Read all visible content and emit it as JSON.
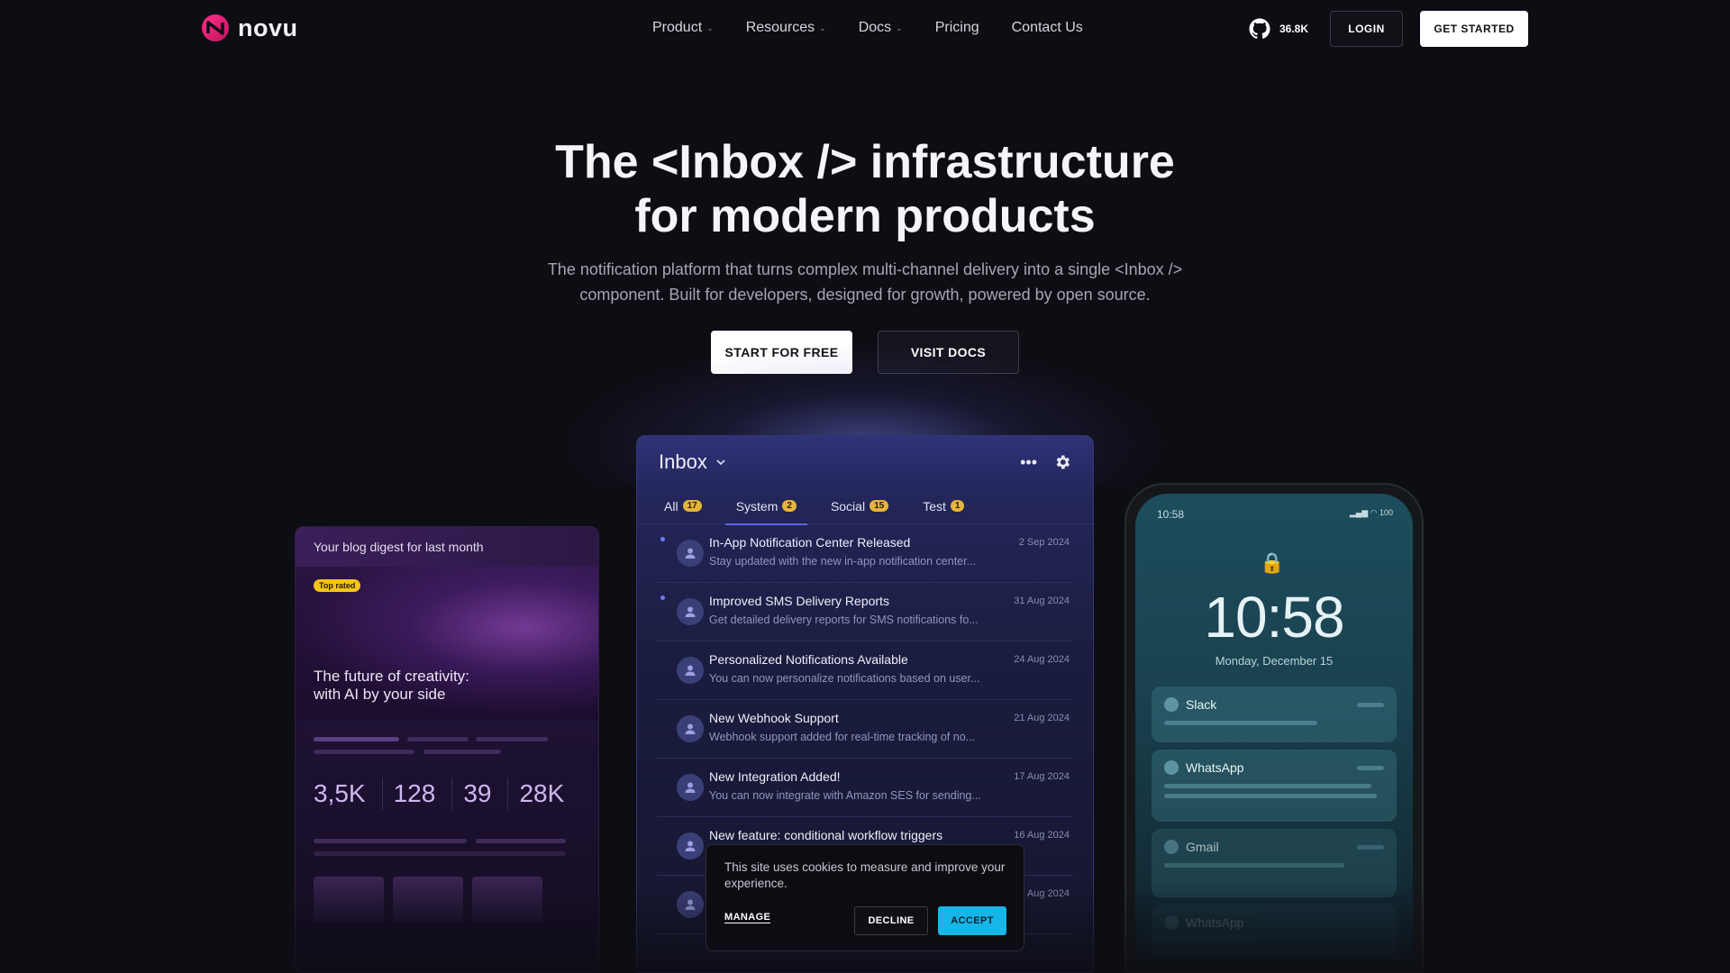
{
  "brand": {
    "name": "novu"
  },
  "nav": {
    "links": [
      {
        "label": "Product",
        "dropdown": true
      },
      {
        "label": "Resources",
        "dropdown": true
      },
      {
        "label": "Docs",
        "dropdown": true
      },
      {
        "label": "Pricing",
        "dropdown": false
      },
      {
        "label": "Contact Us",
        "dropdown": false
      }
    ],
    "github_stars": "36.8K",
    "login_label": "LOGIN",
    "get_started_label": "GET STARTED"
  },
  "hero": {
    "title_line1": "The <Inbox /> infrastructure",
    "title_line2": "for modern products",
    "subtitle_line1": "The notification platform that turns complex multi-channel delivery into a single <Inbox />",
    "subtitle_line2": "component. Built for developers, designed for growth, powered by open source.",
    "cta_primary": "START FOR FREE",
    "cta_secondary": "VISIT DOCS"
  },
  "blog_card": {
    "header": "Your blog digest for last month",
    "badge": "Top rated",
    "headline_line1": "The future of creativity:",
    "headline_line2": "with AI by your side",
    "stats": [
      "3,5K",
      "128",
      "39",
      "28K"
    ]
  },
  "inbox": {
    "title": "Inbox",
    "tabs": [
      {
        "label": "All",
        "count": "17"
      },
      {
        "label": "System",
        "count": "2"
      },
      {
        "label": "Social",
        "count": "15"
      },
      {
        "label": "Test",
        "count": "1"
      }
    ],
    "notifications": [
      {
        "title": "In-App Notification Center Released",
        "snippet": "Stay updated with the new in-app notification center...",
        "date": "2 Sep 2024",
        "unread": true
      },
      {
        "title": "Improved SMS Delivery Reports",
        "snippet": "Get detailed delivery reports for SMS notifications fo...",
        "date": "31 Aug 2024",
        "unread": true
      },
      {
        "title": "Personalized Notifications Available",
        "snippet": "You can now personalize notifications based on user...",
        "date": "24 Aug 2024",
        "unread": false
      },
      {
        "title": "New Webhook Support",
        "snippet": "Webhook support added for real-time tracking of no...",
        "date": "21 Aug 2024",
        "unread": false
      },
      {
        "title": "New Integration Added!",
        "snippet": "You can now integrate with Amazon SES for sending...",
        "date": "17 Aug 2024",
        "unread": false
      },
      {
        "title": "New feature: conditional workflow triggers",
        "snippet": "",
        "date": "16 Aug 2024",
        "unread": false
      },
      {
        "title": "",
        "snippet": "",
        "date": "Aug 2024",
        "unread": false
      }
    ]
  },
  "phone": {
    "status_time": "10:58",
    "battery": "100",
    "clock": "10:58",
    "date": "Monday, December 15",
    "cards": [
      "Slack",
      "WhatsApp",
      "Gmail",
      "WhatsApp"
    ]
  },
  "cookie": {
    "text": "This site uses cookies to measure and improve your experience.",
    "manage_label": "MANAGE",
    "decline_label": "DECLINE",
    "accept_label": "ACCEPT"
  },
  "colors": {
    "accept": "#17b6e8",
    "badge": "#e5b53a",
    "unread_dot": "#6a7bff"
  }
}
